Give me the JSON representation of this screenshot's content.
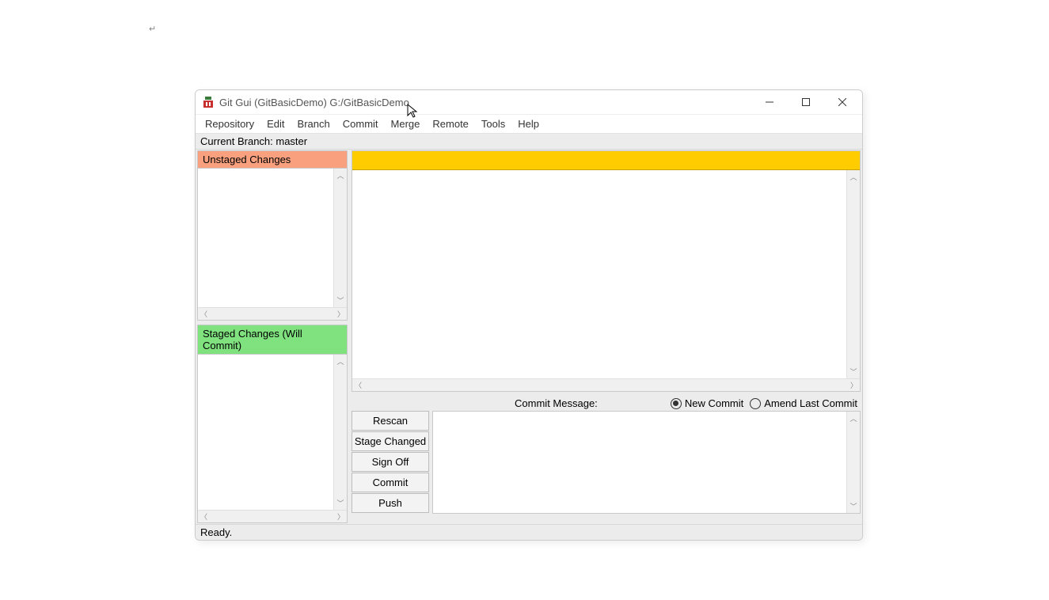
{
  "stray_mark": "↵",
  "window": {
    "title": "Git Gui (GitBasicDemo) G:/GitBasicDemo"
  },
  "menu": {
    "items": [
      "Repository",
      "Edit",
      "Branch",
      "Commit",
      "Merge",
      "Remote",
      "Tools",
      "Help"
    ]
  },
  "branch_bar": "Current Branch: master",
  "panels": {
    "unstaged_header": "Unstaged Changes",
    "staged_header": "Staged Changes (Will Commit)"
  },
  "commit": {
    "label": "Commit Message:",
    "radio_new": "New Commit",
    "radio_amend": "Amend Last Commit",
    "buttons": {
      "rescan": "Rescan",
      "stage_changed": "Stage Changed",
      "sign_off": "Sign Off",
      "commit": "Commit",
      "push": "Push"
    }
  },
  "status": "Ready."
}
